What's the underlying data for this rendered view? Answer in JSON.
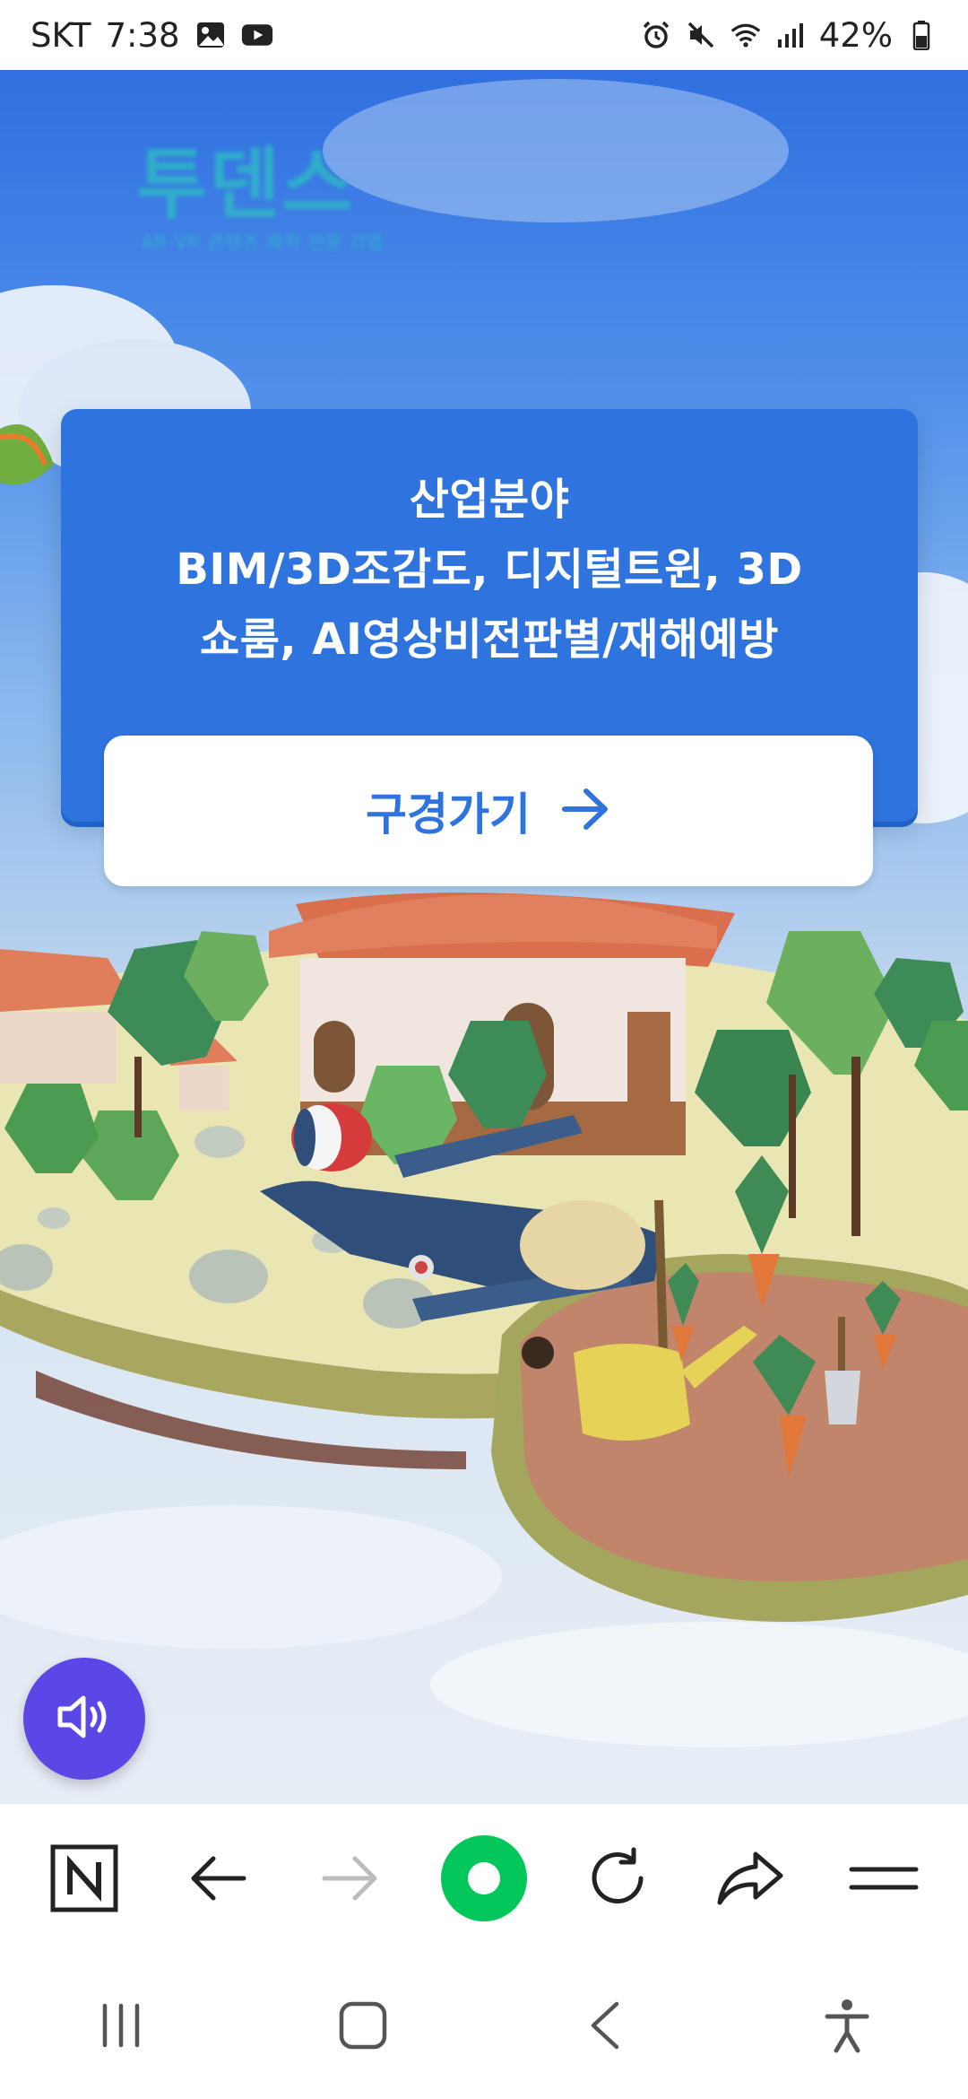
{
  "status_bar": {
    "carrier": "SKT",
    "time": "7:38",
    "battery": "42%",
    "left_icons": [
      "gallery-icon",
      "youtube-icon"
    ],
    "right_icons": [
      "alarm-icon",
      "mute-icon",
      "wifi-icon",
      "signal-icon",
      "battery-icon"
    ]
  },
  "page": {
    "logo": {
      "title": "투덴스",
      "subtitle": "AR·VR 콘텐츠 제작 전문 기업"
    },
    "card": {
      "lines": [
        "산업분야",
        "BIM/3D조감도, 디지털트윈, 3D",
        "쇼룸, AI영상비전판별/재해예방"
      ],
      "button_label": "구경가기",
      "colors": {
        "card_bg": "#2f73de",
        "button_text": "#2f73de"
      }
    },
    "sound_button": {
      "icon": "speaker-icon",
      "color": "#5b47e6"
    }
  },
  "browser_toolbar": {
    "items": [
      "naver-n-icon",
      "back-arrow-icon",
      "forward-arrow-icon",
      "naver-green-dot-icon",
      "refresh-icon",
      "share-icon",
      "menu-icon"
    ],
    "accent": "#03c75a"
  },
  "system_nav": {
    "items": [
      "recents-icon",
      "home-icon",
      "back-icon",
      "accessibility-icon"
    ]
  }
}
